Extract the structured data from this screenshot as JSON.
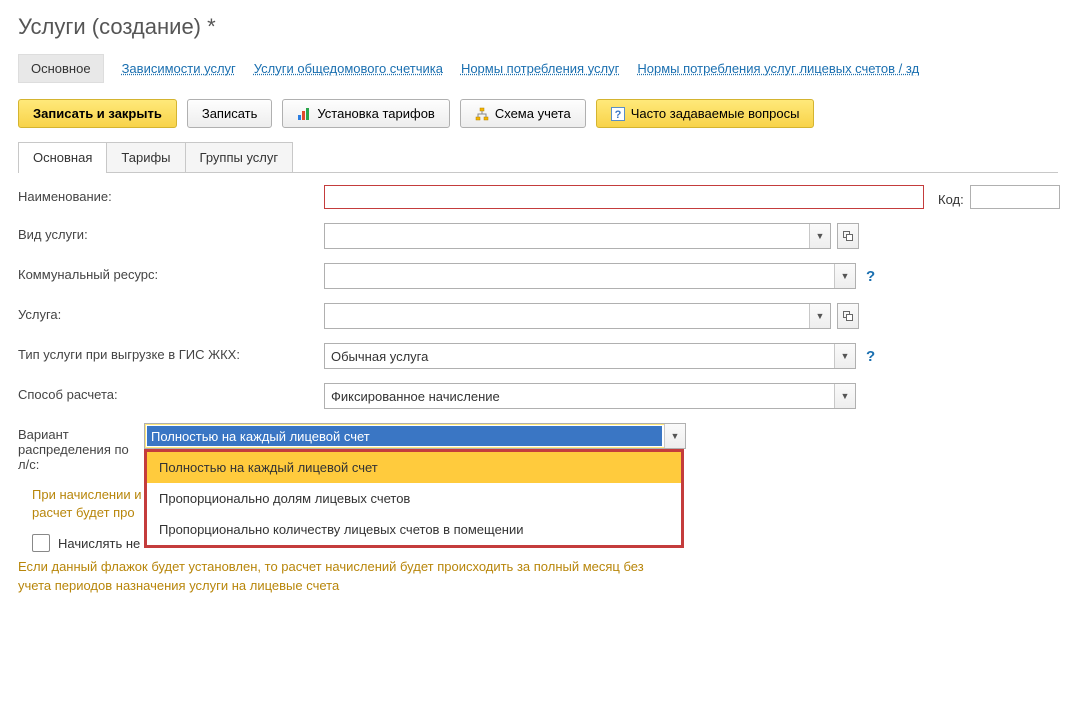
{
  "title": "Услуги (создание) *",
  "nav": {
    "items": [
      "Основное",
      "Зависимости услуг",
      "Услуги общедомового счетчика",
      "Нормы потребления услуг",
      "Нормы потребления услуг лицевых счетов / зд"
    ]
  },
  "toolbar": {
    "save_close": "Записать и закрыть",
    "save": "Записать",
    "tariffs": "Установка тарифов",
    "scheme": "Схема учета",
    "faq": "Часто задаваемые вопросы"
  },
  "inner_tabs": [
    "Основная",
    "Тарифы",
    "Группы услуг"
  ],
  "form": {
    "name_label": "Наименование:",
    "name_value": "",
    "code_label": "Код:",
    "code_value": "",
    "service_type_label": "Вид услуги:",
    "service_type_value": "",
    "resource_label": "Коммунальный ресурс:",
    "resource_value": "",
    "service_label": "Услуга:",
    "service_value": "",
    "gis_type_label": "Тип услуги при выгрузке в ГИС ЖКХ:",
    "gis_type_value": "Обычная услуга",
    "calc_method_label": "Способ расчета:",
    "calc_method_value": "Фиксированное начисление",
    "variant_label": "Вариант распределения по л/с:",
    "variant_value": "Полностью на каждый лицевой счет",
    "variant_options": [
      "Полностью на каждый лицевой счет",
      "Пропорционально долям лицевых счетов",
      "Пропорционально количеству лицевых счетов в помещении"
    ],
    "hint1": "При начислении и",
    "hint1_cut": "расчет будет про",
    "checkbox_label": "Начислять не",
    "hint2": "Если данный флажок будет установлен, то расчет начислений будет происходить за полный месяц без учета периодов назначения услуги на лицевые счета"
  }
}
